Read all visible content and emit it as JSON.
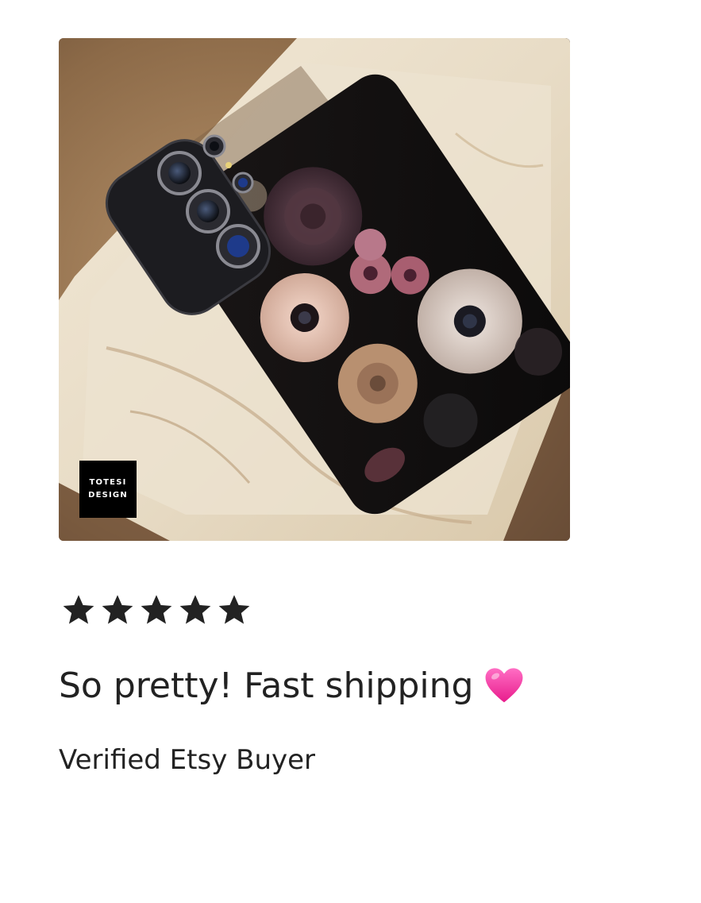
{
  "review": {
    "photo": {
      "watermark_line1": "TOTESI",
      "watermark_line2": "DESIGN"
    },
    "rating": 5,
    "rating_max": 5,
    "text": "So pretty! Fast shipping",
    "emoji_icon": "pink-heart-icon",
    "reviewer": "Verified Etsy Buyer"
  },
  "colors": {
    "text": "#222222",
    "star": "#222222",
    "heart": "#ff3fa4",
    "background": "#ffffff"
  }
}
